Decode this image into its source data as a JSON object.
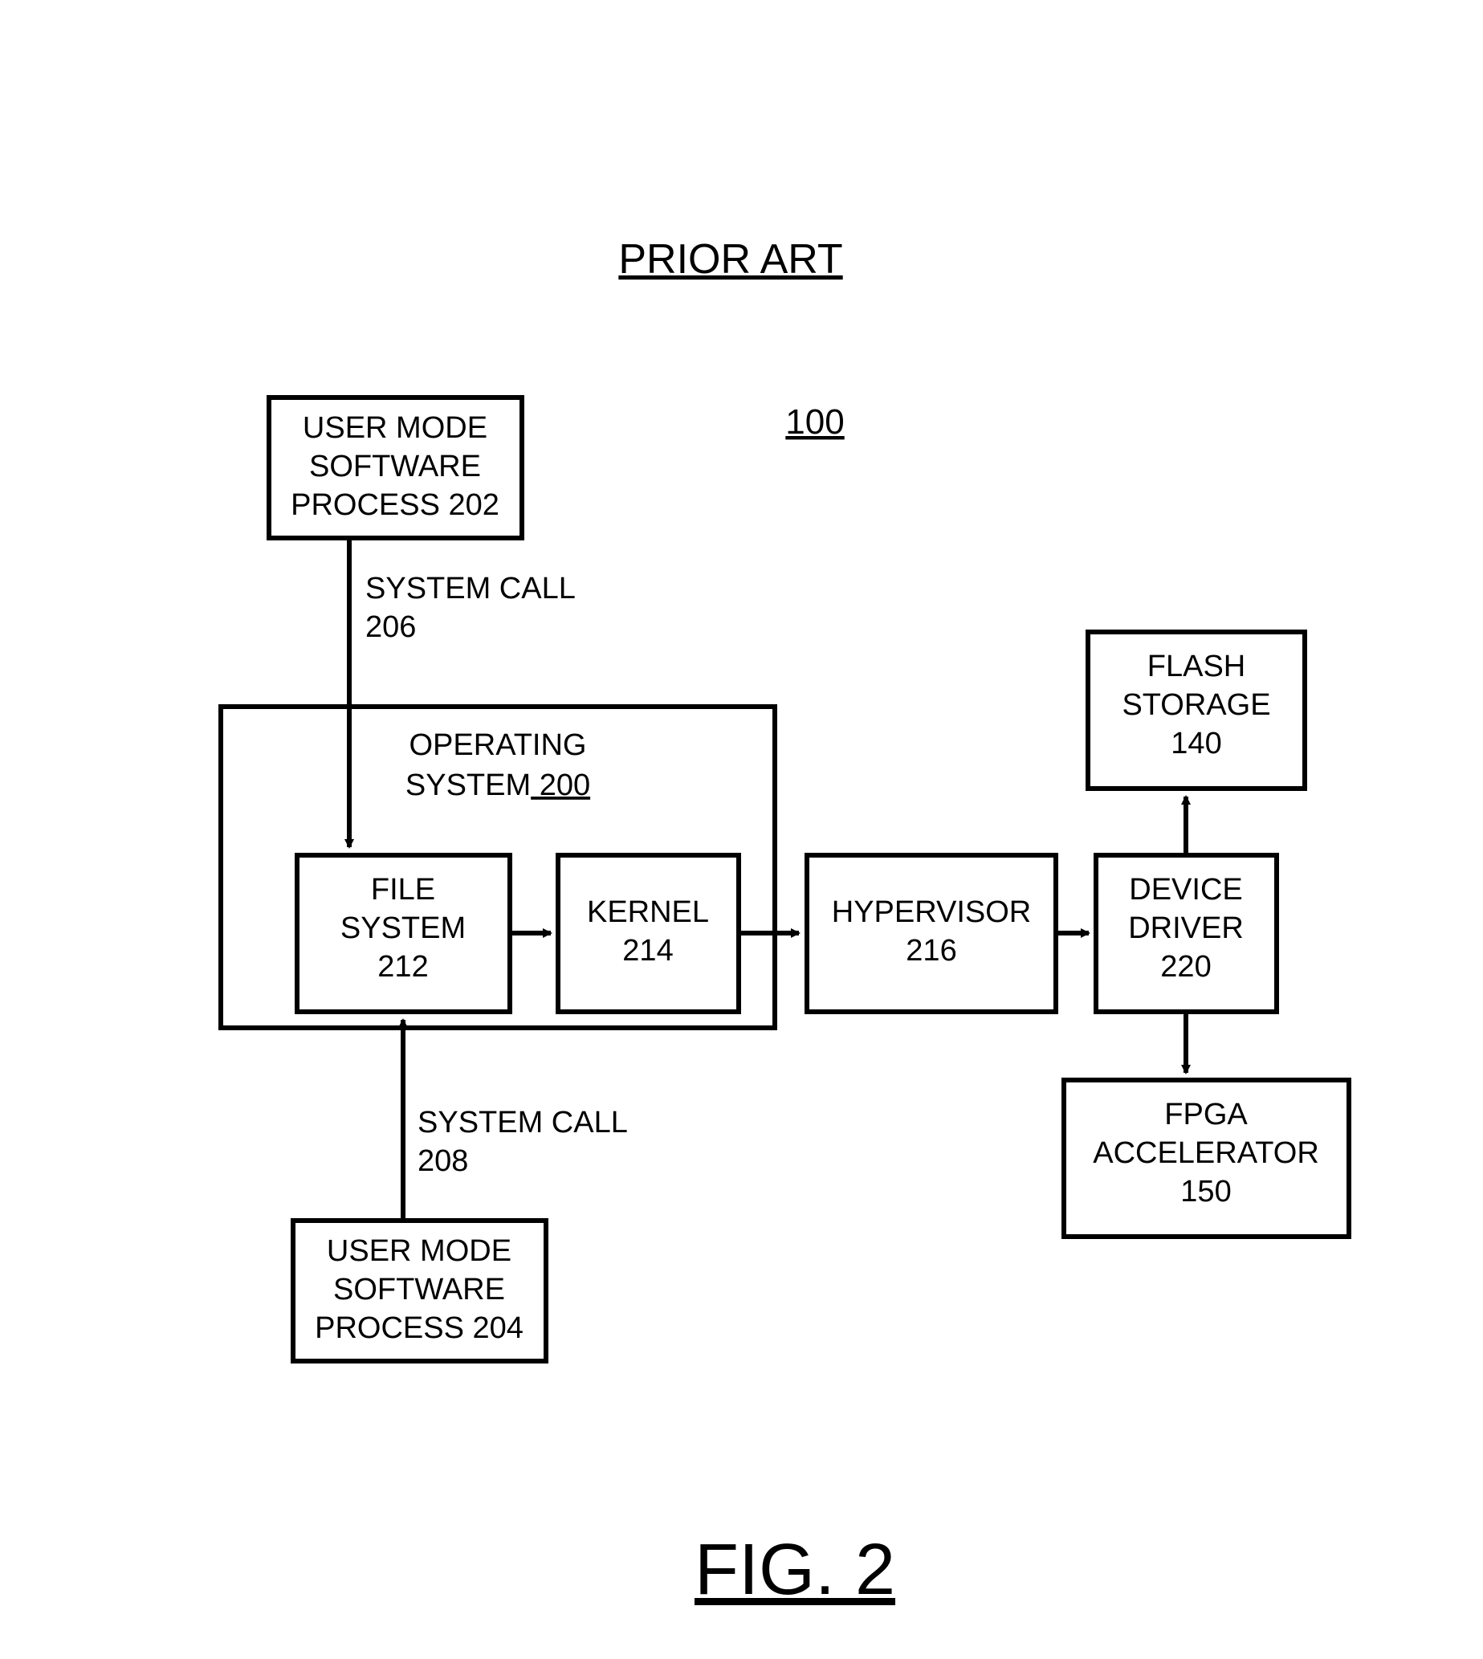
{
  "header": {
    "title": "PRIOR ART",
    "diagram_ref": "100",
    "figure": "FIG. 2"
  },
  "boxes": {
    "user_proc_top": {
      "l1": "USER MODE",
      "l2": "SOFTWARE",
      "l3": "PROCESS 202"
    },
    "user_proc_bot": {
      "l1": "USER MODE",
      "l2": "SOFTWARE",
      "l3": "PROCESS 204"
    },
    "os": {
      "l1": "OPERATING",
      "l2a": "SYSTEM",
      "l2b": " 200"
    },
    "file_system": {
      "l1": "FILE",
      "l2": "SYSTEM",
      "l3": "212"
    },
    "kernel": {
      "l1": "KERNEL",
      "l2": "214"
    },
    "hypervisor": {
      "l1": "HYPERVISOR",
      "l2": "216"
    },
    "device_driver": {
      "l1": "DEVICE",
      "l2": "DRIVER",
      "l3": "220"
    },
    "flash_storage": {
      "l1": "FLASH",
      "l2": "STORAGE",
      "l3": "140"
    },
    "fpga": {
      "l1": "FPGA",
      "l2": "ACCELERATOR",
      "l3": "150"
    }
  },
  "labels": {
    "syscall_top": {
      "l1": "SYSTEM CALL",
      "l2": "206"
    },
    "syscall_bot": {
      "l1": "SYSTEM CALL",
      "l2": "208"
    }
  }
}
